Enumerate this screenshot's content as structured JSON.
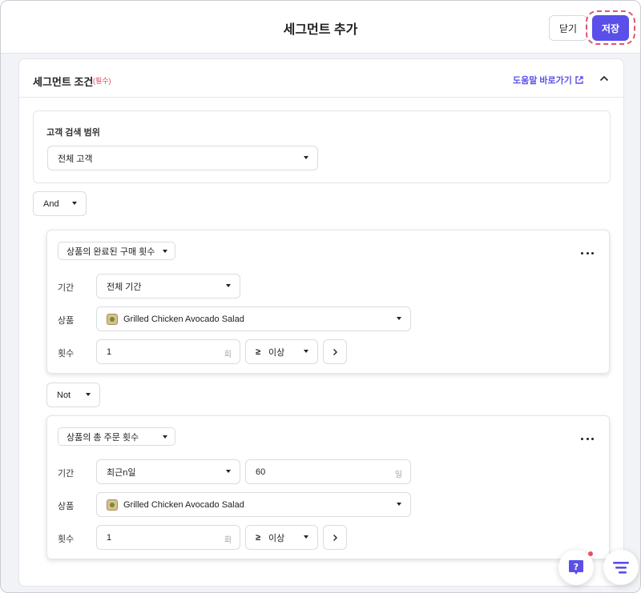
{
  "header": {
    "title": "세그먼트 추가",
    "close_label": "닫기",
    "save_label": "저장"
  },
  "panel": {
    "title": "세그먼트 조건",
    "required_note": "(필수)",
    "help_link": "도움말 바로가기"
  },
  "scope": {
    "label": "고객 검색 범위",
    "value": "전체 고객"
  },
  "operator1": "And",
  "condition1": {
    "type": "상품의 완료된 구매 횟수",
    "period_label": "기간",
    "period_value": "전체 기간",
    "product_label": "상품",
    "product_value": "Grilled Chicken Avocado Salad",
    "count_label": "횟수",
    "count_value": "1",
    "count_unit": "회",
    "compare_symbol": "≥",
    "compare_value": "이상"
  },
  "operator2": "Not",
  "condition2": {
    "type": "상품의 총 주문 횟수",
    "period_label": "기간",
    "period_value": "최근n일",
    "days_value": "60",
    "days_unit": "일",
    "product_label": "상품",
    "product_value": "Grilled Chicken Avocado Salad",
    "count_label": "횟수",
    "count_value": "1",
    "count_unit": "회",
    "compare_symbol": "≥",
    "compare_value": "이상"
  },
  "colors": {
    "accent": "#5b4fe9",
    "required": "#e0445e",
    "highlight_ring": "#e0536f"
  },
  "icons": {
    "help": "question-chat-icon",
    "menu": "filter-lines-icon"
  }
}
